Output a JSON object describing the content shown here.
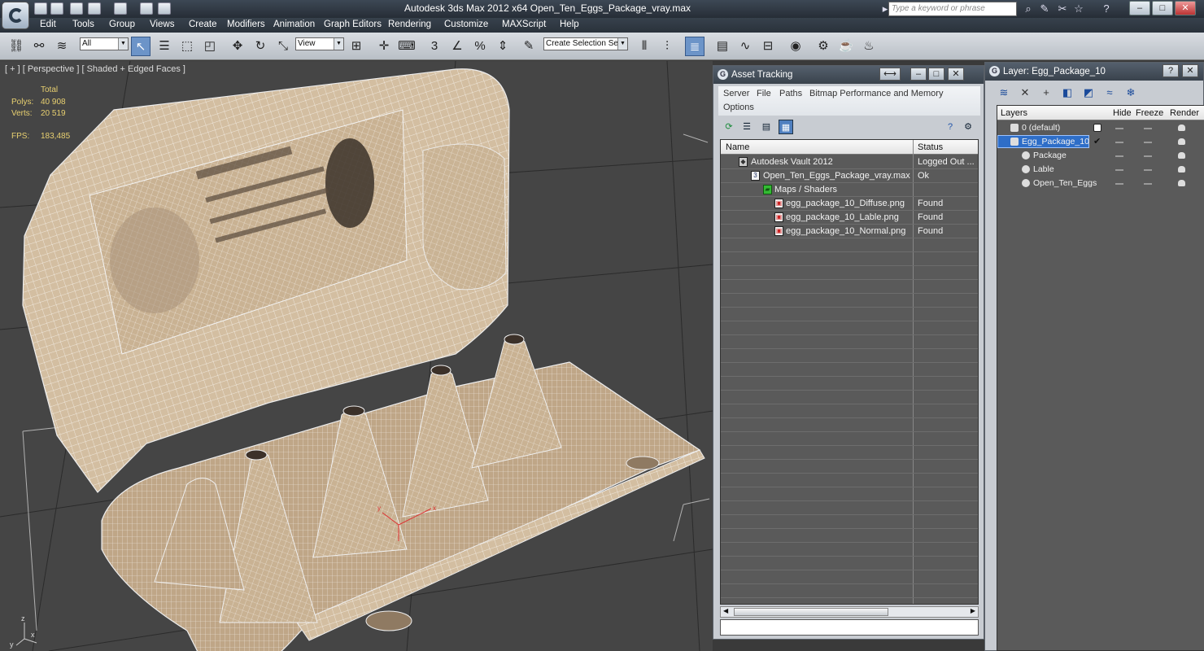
{
  "window": {
    "title": "Autodesk 3ds Max  2012 x64      Open_Ten_Eggs_Package_vray.max",
    "search_placeholder": "Type a keyword or phrase",
    "controls": [
      "–",
      "□",
      "✕"
    ]
  },
  "menu": [
    "Edit",
    "Tools",
    "Group",
    "Views",
    "Create",
    "Modifiers",
    "Animation",
    "Graph Editors",
    "Rendering",
    "Customize",
    "MAXScript",
    "Help"
  ],
  "toolbar": {
    "selection_filter": "All",
    "reference_coord": "View",
    "named_selection": "Create Selection Se"
  },
  "viewport": {
    "label": "[ + ] [ Perspective ] [ Shaded + Edged Faces ]",
    "stats": {
      "total_label": "Total",
      "polys_label": "Polys:",
      "polys_value": "40 908",
      "verts_label": "Verts:",
      "verts_value": "20 519",
      "fps_label": "FPS:",
      "fps_value": "183,485"
    },
    "axis_x": "x",
    "axis_y": "y",
    "axis_z": "z"
  },
  "asset_tracking": {
    "title": "Asset Tracking",
    "menu": [
      "Server",
      "File",
      "Paths",
      "Bitmap Performance and Memory",
      "Options"
    ],
    "columns": {
      "name": "Name",
      "status": "Status"
    },
    "rows": [
      {
        "name": "Autodesk Vault 2012",
        "status": "Logged Out ..."
      },
      {
        "name": "Open_Ten_Eggs_Package_vray.max",
        "status": "Ok"
      },
      {
        "name": "Maps / Shaders",
        "status": ""
      },
      {
        "name": "egg_package_10_Diffuse.png",
        "status": "Found"
      },
      {
        "name": "egg_package_10_Lable.png",
        "status": "Found"
      },
      {
        "name": "egg_package_10_Normal.png",
        "status": "Found"
      }
    ]
  },
  "layer_window": {
    "title": "Layer: Egg_Package_10",
    "columns": {
      "layers": "Layers",
      "hide": "Hide",
      "freeze": "Freeze",
      "render": "Render"
    },
    "rows": [
      {
        "name": "0 (default)"
      },
      {
        "name": "Egg_Package_10"
      },
      {
        "name": "Package"
      },
      {
        "name": "Lable"
      },
      {
        "name": "Open_Ten_Eggs"
      }
    ]
  },
  "colors": {
    "background": "#454545",
    "mesh": "#d8c4a8",
    "wire": "#ffffff",
    "selection": "#2e6ec8",
    "stats": "#e8d070"
  }
}
